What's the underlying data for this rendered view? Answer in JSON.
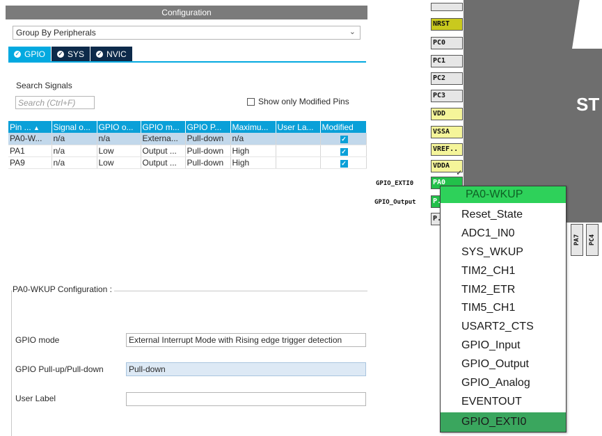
{
  "config": {
    "title": "Configuration",
    "group_by": "Group By Peripherals",
    "tabs": [
      {
        "label": "GPIO",
        "active": true
      },
      {
        "label": "SYS",
        "active": false
      },
      {
        "label": "NVIC",
        "active": false
      }
    ],
    "search": {
      "label": "Search Signals",
      "placeholder": "Search (Ctrl+F)",
      "value": ""
    },
    "show_modified": {
      "label": "Show only Modified Pins",
      "checked": false
    },
    "table": {
      "columns": [
        "Pin ...",
        "Signal o...",
        "GPIO o...",
        "GPIO m...",
        "GPIO P...",
        "Maximu...",
        "User La...",
        "Modified"
      ],
      "rows": [
        {
          "pin": "PA0-W...",
          "signal": "n/a",
          "output": "n/a",
          "mode": "Externa...",
          "pull": "Pull-down",
          "speed": "n/a",
          "label": "",
          "modified": true,
          "selected": true
        },
        {
          "pin": "PA1",
          "signal": "n/a",
          "output": "Low",
          "mode": "Output ...",
          "pull": "Pull-down",
          "speed": "High",
          "label": "",
          "modified": true,
          "selected": false
        },
        {
          "pin": "PA9",
          "signal": "n/a",
          "output": "Low",
          "mode": "Output ...",
          "pull": "Pull-down",
          "speed": "High",
          "label": "",
          "modified": true,
          "selected": false
        }
      ]
    },
    "pin_config": {
      "title": "PA0-WKUP Configuration :",
      "gpio_mode_label": "GPIO mode",
      "gpio_mode_value": "External Interrupt Mode with Rising edge trigger detection",
      "pull_label": "GPIO Pull-up/Pull-down",
      "pull_value": "Pull-down",
      "user_label_label": "User Label",
      "user_label_value": ""
    }
  },
  "chip": {
    "logo": "ST",
    "left_pins": [
      "NRST",
      "PC0",
      "PC1",
      "PC2",
      "PC3",
      "VDD",
      "VSSA",
      "VREF..",
      "VDDA",
      "PA0",
      "P..",
      "P.."
    ],
    "bottom_pins": [
      "PA7",
      "PC4"
    ],
    "signal_labels": [
      "GPIO_EXTI0",
      "GPIO_Output"
    ]
  },
  "pin_menu": {
    "header": "PA0-WKUP",
    "items": [
      "Reset_State",
      "ADC1_IN0",
      "SYS_WKUP",
      "TIM2_CH1",
      "TIM2_ETR",
      "TIM5_CH1",
      "USART2_CTS",
      "GPIO_Input",
      "GPIO_Output",
      "GPIO_Analog",
      "EVENTOUT",
      "GPIO_EXTI0"
    ],
    "active_item": "GPIO_EXTI0"
  },
  "colors": {
    "tab_active": "#03a9e0",
    "tab_inactive": "#0d2a4a",
    "table_header": "#0aa0d8",
    "row_selected": "#c2d8eb",
    "pin_green": "#22c04a",
    "menu_header": "#2ed15a",
    "menu_active": "#3aa65e",
    "chip_gray": "#6e6e6e"
  }
}
